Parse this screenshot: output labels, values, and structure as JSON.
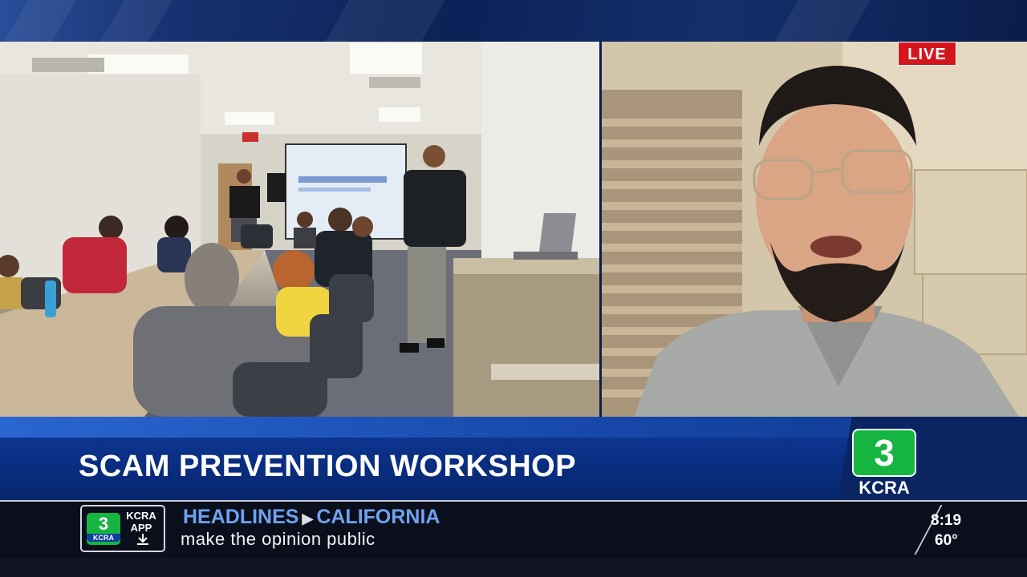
{
  "broadcast": {
    "live_label": "LIVE",
    "headline": "SCAM PREVENTION WORKSHOP",
    "station_logo_number": "3",
    "station_logo_text": "KCRA"
  },
  "ticker": {
    "app_logo_number": "3",
    "app_logo_text": "KCRA",
    "app_label": "KCRA APP",
    "app_download_icon": "download-icon",
    "section": "HEADLINES",
    "subsection": "CALIFORNIA",
    "text": "make the opinion public",
    "time": "8:19",
    "temperature": "60°"
  },
  "colors": {
    "live_red": "#d4151c",
    "logo_green": "#16b441",
    "banner_blue": "#0a2f84",
    "ticker_accent": "#6fa2f0"
  }
}
